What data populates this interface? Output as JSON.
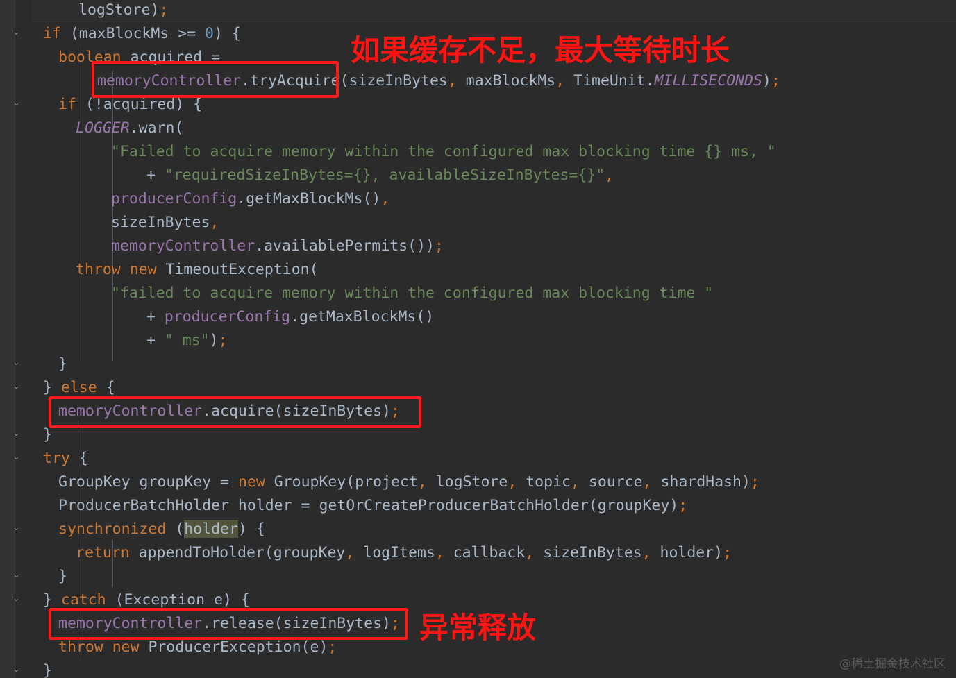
{
  "editor": {
    "background": "#2b2b2b",
    "gutter_background": "#313335",
    "foreground": "#a9b7c6",
    "language": "Java"
  },
  "code": {
    "lines": [
      {
        "indent": 5,
        "text": "logStore);"
      },
      {
        "indent": 2,
        "text": "if (maxBlockMs >= 0) {"
      },
      {
        "indent": 3,
        "text": "boolean acquired ="
      },
      {
        "indent": 6,
        "text": "memoryController.tryAcquire(sizeInBytes, maxBlockMs, TimeUnit.MILLISECONDS);"
      },
      {
        "indent": 3,
        "text": "if (!acquired) {"
      },
      {
        "indent": 4,
        "text": "LOGGER.warn("
      },
      {
        "indent": 6,
        "text": "\"Failed to acquire memory within the configured max blocking time {} ms, \""
      },
      {
        "indent": 8,
        "text": "+ \"requiredSizeInBytes={}, availableSizeInBytes={}\","
      },
      {
        "indent": 6,
        "text": "producerConfig.getMaxBlockMs(),"
      },
      {
        "indent": 6,
        "text": "sizeInBytes,"
      },
      {
        "indent": 6,
        "text": "memoryController.availablePermits());"
      },
      {
        "indent": 4,
        "text": "throw new TimeoutException("
      },
      {
        "indent": 6,
        "text": "\"failed to acquire memory within the configured max blocking time \""
      },
      {
        "indent": 8,
        "text": "+ producerConfig.getMaxBlockMs()"
      },
      {
        "indent": 8,
        "text": "+ \" ms\");"
      },
      {
        "indent": 3,
        "text": "}"
      },
      {
        "indent": 2,
        "text": "} else {"
      },
      {
        "indent": 3,
        "text": "memoryController.acquire(sizeInBytes);"
      },
      {
        "indent": 2,
        "text": "}"
      },
      {
        "indent": 2,
        "text": "try {"
      },
      {
        "indent": 3,
        "text": "GroupKey groupKey = new GroupKey(project, logStore, topic, source, shardHash);"
      },
      {
        "indent": 3,
        "text": "ProducerBatchHolder holder = getOrCreateProducerBatchHolder(groupKey);"
      },
      {
        "indent": 3,
        "text": "synchronized (holder) {"
      },
      {
        "indent": 4,
        "text": "return appendToHolder(groupKey, logItems, callback, sizeInBytes, holder);"
      },
      {
        "indent": 3,
        "text": "}"
      },
      {
        "indent": 2,
        "text": "} catch (Exception e) {"
      },
      {
        "indent": 3,
        "text": "memoryController.release(sizeInBytes);"
      },
      {
        "indent": 3,
        "text": "throw new ProducerException(e);"
      },
      {
        "indent": 2,
        "text": "}"
      }
    ]
  },
  "annotations": {
    "color": "#ff1414",
    "notes": [
      {
        "id": "note-max-wait",
        "text": "如果缓存不足，最大等待时长"
      },
      {
        "id": "note-exception-release",
        "text": "异常释放"
      }
    ],
    "highlight_boxes": [
      {
        "id": "box-try-acquire",
        "target": "memoryController.tryAcquire"
      },
      {
        "id": "box-acquire",
        "target": "memoryController.acquire(sizeInBytes);"
      },
      {
        "id": "box-release",
        "target": "memoryController.release(sizeInBytes);"
      }
    ]
  },
  "watermark": {
    "text": "@稀土掘金技术社区"
  }
}
